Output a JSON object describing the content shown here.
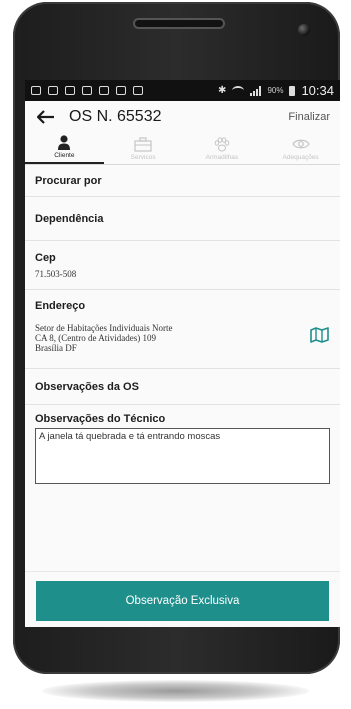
{
  "status_bar": {
    "battery": "90%",
    "time": "10:34"
  },
  "header": {
    "title": "OS N. 65532",
    "action": "Finalizar"
  },
  "tabs": [
    {
      "label": "Cliente",
      "icon": "person-icon",
      "active": true
    },
    {
      "label": "Servicos",
      "icon": "briefcase-icon",
      "active": false
    },
    {
      "label": "Armadilhas",
      "icon": "paw-icon",
      "active": false
    },
    {
      "label": "Adequações",
      "icon": "eye-icon",
      "active": false
    }
  ],
  "fields": {
    "search": {
      "label": "Procurar por"
    },
    "dependency": {
      "label": "Dependência"
    },
    "cep": {
      "label": "Cep",
      "value": "71.503-508"
    },
    "address": {
      "label": "Endereço",
      "line1": "Setor de Habitações Individuais Norte",
      "line2": "CA 8, (Centro de Atividades)  109",
      "line3": "Brasília DF",
      "icon": "map-icon"
    },
    "os_notes": {
      "label": "Observações da OS"
    },
    "tech_notes": {
      "label": "Observações do Técnico",
      "value": "A janela tá quebrada e tá entrando moscas"
    }
  },
  "exclusive_button": {
    "label": "Observação Exclusiva"
  },
  "colors": {
    "accent": "#1f8f8c",
    "inactive_tab": "#c4c4c4"
  }
}
